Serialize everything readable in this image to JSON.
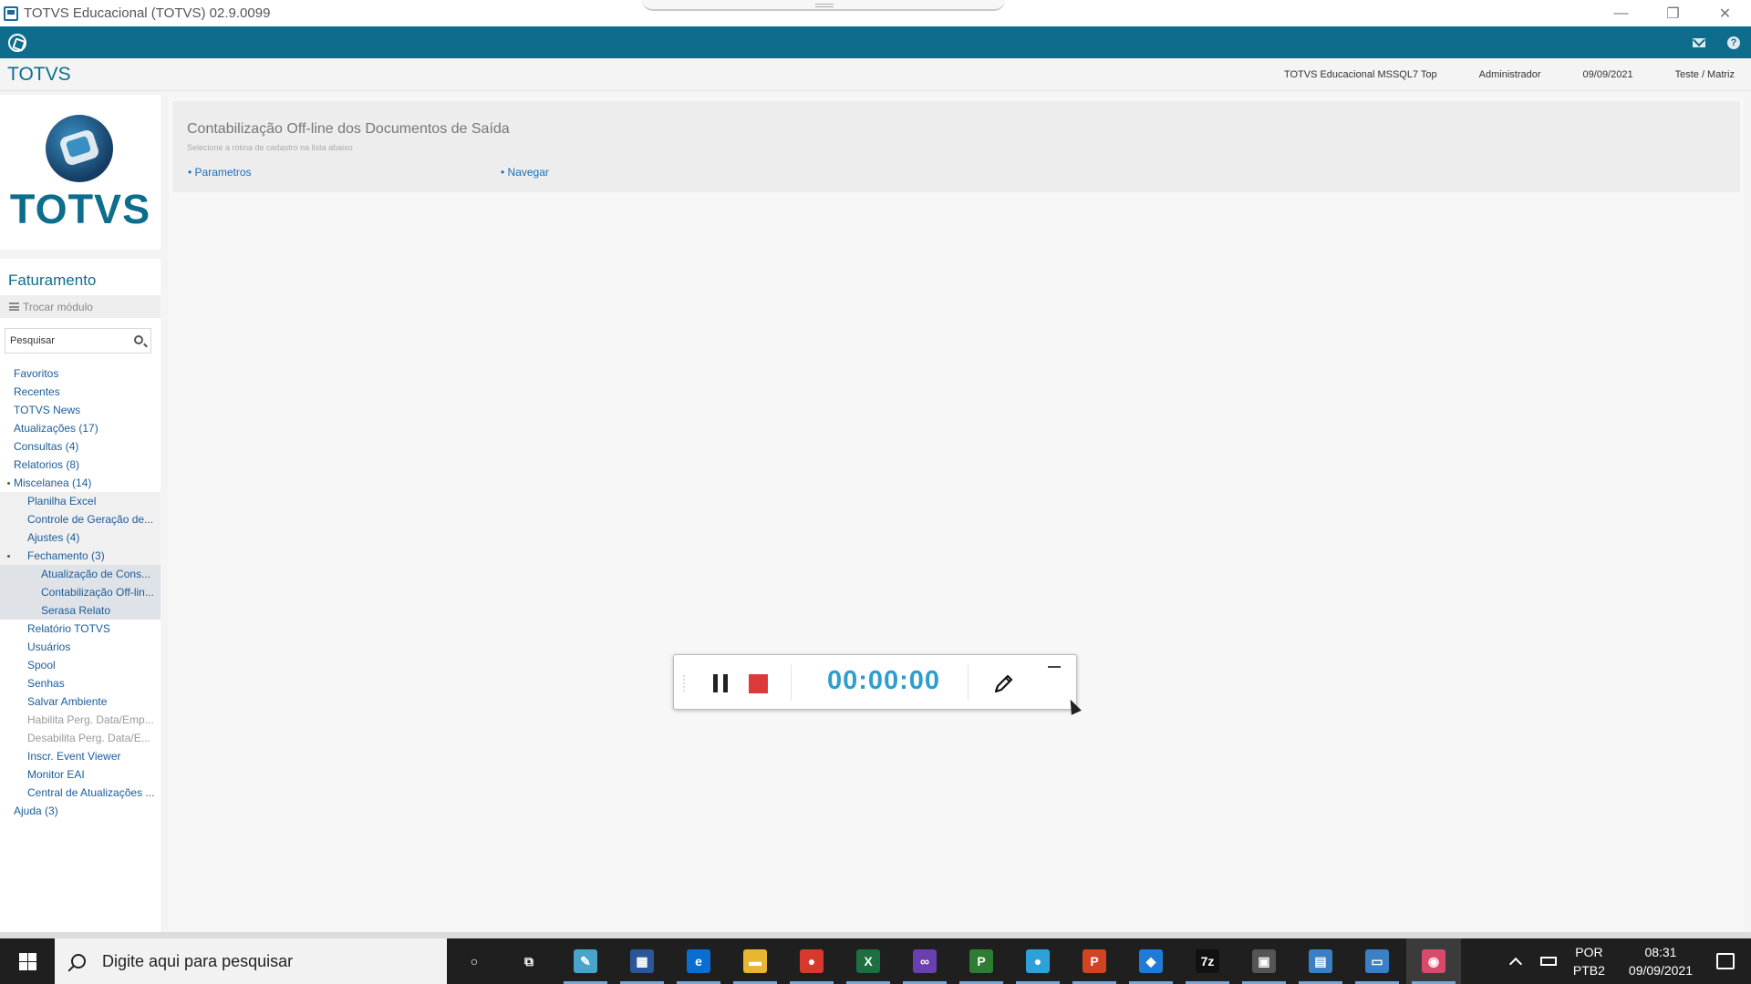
{
  "window": {
    "title": "TOTVS Educacional (TOTVS) 02.9.0099",
    "controls": [
      "—",
      "❐",
      "✕"
    ]
  },
  "header": {
    "brand": "TOTVS",
    "environment": "TOTVS Educacional MSSQL7 Top",
    "user": "Administrador",
    "date": "09/09/2021",
    "company": "Teste / Matriz"
  },
  "sidebar": {
    "logo_text": "TOTVS",
    "module_title": "Faturamento",
    "switch_module": "Trocar módulo",
    "search_placeholder": "Pesquisar",
    "items": [
      {
        "label": "Favoritos",
        "level": 0
      },
      {
        "label": "Recentes",
        "level": 0
      },
      {
        "label": "TOTVS News",
        "level": 0
      },
      {
        "label": "Atualizações (17)",
        "level": 0
      },
      {
        "label": "Consultas (4)",
        "level": 0
      },
      {
        "label": "Relatorios (8)",
        "level": 0
      },
      {
        "label": "Miscelanea (14)",
        "level": 0
      },
      {
        "label": "Planilha Excel",
        "level": 1
      },
      {
        "label": "Controle de Geração de...",
        "level": 1
      },
      {
        "label": "Ajustes (4)",
        "level": 1
      },
      {
        "label": "Fechamento (3)",
        "level": 1
      },
      {
        "label": "Atualização de Cons...",
        "level": 2
      },
      {
        "label": "Contabilização Off-lin...",
        "level": 2
      },
      {
        "label": "Serasa Relato",
        "level": 2
      },
      {
        "label": "Relatório TOTVS",
        "level": 1
      },
      {
        "label": "Usuários",
        "level": 1
      },
      {
        "label": "Spool",
        "level": 1
      },
      {
        "label": "Senhas",
        "level": 1
      },
      {
        "label": "Salvar Ambiente",
        "level": 1
      },
      {
        "label": "Habilita Perg. Data/Emp...",
        "level": 1
      },
      {
        "label": "Desabilita Perg. Data/E...",
        "level": 1
      },
      {
        "label": "Inscr. Event Viewer",
        "level": 1
      },
      {
        "label": "Monitor EAI",
        "level": 1
      },
      {
        "label": "Central de Atualizações ...",
        "level": 1
      },
      {
        "label": "Ajuda (3)",
        "level": 0
      }
    ]
  },
  "main": {
    "title": "Contabilização Off-line dos Documentos de Saída",
    "subtitle": "Selecione a rotina de cadastro na lista abaixo",
    "links": [
      "• Parametros",
      "• Navegar"
    ]
  },
  "recorder": {
    "time": "00:00:00"
  },
  "taskbar": {
    "search_placeholder": "Digite aqui para pesquisar",
    "language": "POR",
    "layout": "PTB2",
    "time": "08:31",
    "date": "09/09/2021",
    "apps": [
      {
        "name": "cortana-icon",
        "glyph": "○",
        "color": "#1f1f1f"
      },
      {
        "name": "task-view-icon",
        "glyph": "⧉",
        "color": "#1f1f1f"
      },
      {
        "name": "notepad-icon",
        "glyph": "✎",
        "color": "#4aa3c8"
      },
      {
        "name": "store-icon",
        "glyph": "▦",
        "color": "#2b5797"
      },
      {
        "name": "edge-icon",
        "glyph": "e",
        "color": "#0a6ed1"
      },
      {
        "name": "explorer-icon",
        "glyph": "▬",
        "color": "#e8b631"
      },
      {
        "name": "chrome-icon",
        "glyph": "●",
        "color": "#d6392d"
      },
      {
        "name": "excel-icon",
        "glyph": "X",
        "color": "#1d6f42"
      },
      {
        "name": "visual-studio-icon",
        "glyph": "∞",
        "color": "#6a3fb0"
      },
      {
        "name": "project-icon",
        "glyph": "P",
        "color": "#2e7d32"
      },
      {
        "name": "chrome-alt-icon",
        "glyph": "●",
        "color": "#2ea2d8"
      },
      {
        "name": "powerpoint-icon",
        "glyph": "P",
        "color": "#d04423"
      },
      {
        "name": "vscode-icon",
        "glyph": "◆",
        "color": "#1f7ad8"
      },
      {
        "name": "7zip-icon",
        "glyph": "7z",
        "color": "#111111"
      },
      {
        "name": "app-window-icon",
        "glyph": "▣",
        "color": "#555555"
      },
      {
        "name": "remote-desktop-icon",
        "glyph": "▤",
        "color": "#3b7fc4"
      },
      {
        "name": "totvs-app-icon",
        "glyph": "▭",
        "color": "#3b7fc4"
      },
      {
        "name": "recorder-app-icon",
        "glyph": "◉",
        "color": "#d94a6a"
      }
    ]
  }
}
